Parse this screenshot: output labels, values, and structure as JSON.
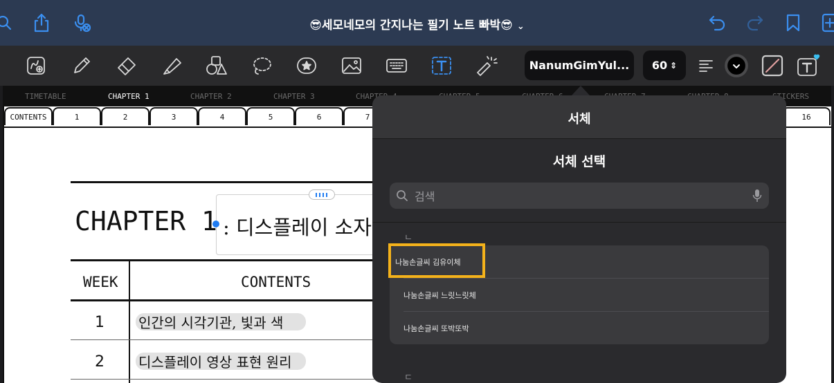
{
  "title_bar": {
    "doc_title": "😎세모네모의 간지나는 필기 노트 빠박😎",
    "icons": [
      "search-icon",
      "share-icon",
      "mic-off-icon",
      "undo-icon",
      "redo-icon",
      "bookmark-icon",
      "add-page-icon"
    ]
  },
  "toolbar": {
    "tools": [
      "lasso-image-icon",
      "pen-icon",
      "eraser-icon",
      "highlighter-icon",
      "shapes-icon",
      "lasso-icon",
      "sticker-icon",
      "image-icon",
      "keyboard-icon",
      "text-tool-icon",
      "laser-pointer-icon"
    ],
    "font_name": "NanumGimYul...",
    "font_size": "60",
    "accent_color": "#3b8ff0"
  },
  "chapters": [
    "TIMETABLE",
    "CHAPTER 1",
    "CHAPTER 2",
    "CHAPTER 3",
    "CHAPTER 4",
    "CHAPTER 5",
    "CHAPTER 6",
    "CHAPTER 7",
    "CHAPTER 8",
    "STICKERS"
  ],
  "tabs": [
    "CONTENTS",
    "1",
    "2",
    "3",
    "4",
    "5",
    "6",
    "7"
  ],
  "last_tab": "16",
  "document": {
    "heading": "CHAPTER 1",
    "heading_suffix": ": 디스플레이 소자",
    "table": {
      "col_week": "WEEK",
      "col_contents": "CONTENTS",
      "rows": [
        {
          "week": "1",
          "content": "인간의 시각기관, 빛과 색"
        },
        {
          "week": "2",
          "content": "디스플레이 영상 표현 원리"
        }
      ]
    }
  },
  "font_popover": {
    "title": "서체",
    "subtitle": "서체 선택",
    "search_placeholder": "검색",
    "section_top": "ㄴ",
    "section_bottom": "ㄷ",
    "fonts": [
      "나눔손글씨 김유이체",
      "나눔손글씨 느릿느릿체",
      "나눔손글씨 또박또박"
    ],
    "highlight_color": "#f4b21b"
  }
}
